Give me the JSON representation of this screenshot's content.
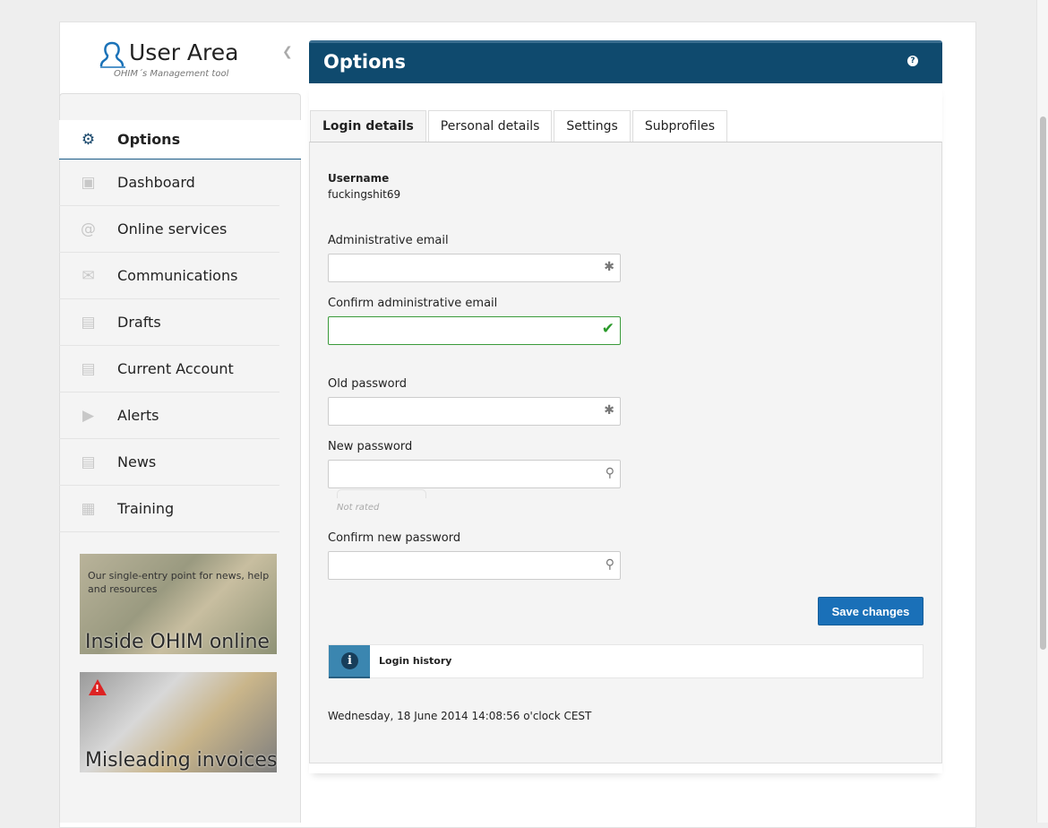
{
  "logo": {
    "title": "User Area",
    "subtitle": "OHIM´s Management tool"
  },
  "sidebar": {
    "active": {
      "label": "Options",
      "icon": "gear-icon"
    },
    "items": [
      {
        "label": "Dashboard",
        "icon": "dashboard-icon"
      },
      {
        "label": "Online services",
        "icon": "at-icon"
      },
      {
        "label": "Communications",
        "icon": "envelope-icon"
      },
      {
        "label": "Drafts",
        "icon": "drafts-icon"
      },
      {
        "label": "Current Account",
        "icon": "wallet-icon"
      },
      {
        "label": "Alerts",
        "icon": "megaphone-icon"
      },
      {
        "label": "News",
        "icon": "newspaper-icon"
      },
      {
        "label": "Training",
        "icon": "presentation-icon"
      }
    ],
    "promos": [
      {
        "text": "Our single-entry point for news, help and resources",
        "title": "Inside OHIM online"
      },
      {
        "title": "Misleading invoices"
      }
    ]
  },
  "panel": {
    "title": "Options",
    "tabs": [
      "Login details",
      "Personal details",
      "Settings",
      "Subprofiles"
    ]
  },
  "form": {
    "username_label": "Username",
    "username": "fuckingshit69",
    "admin_email_label": "Administrative email",
    "confirm_email_label": "Confirm administrative email",
    "old_password_label": "Old password",
    "new_password_label": "New password",
    "strength": "Not rated",
    "confirm_password_label": "Confirm new password",
    "save": "Save changes"
  },
  "login_history": "Login history",
  "timestamp": "Wednesday, 18 June 2014 14:08:56 o'clock CEST"
}
